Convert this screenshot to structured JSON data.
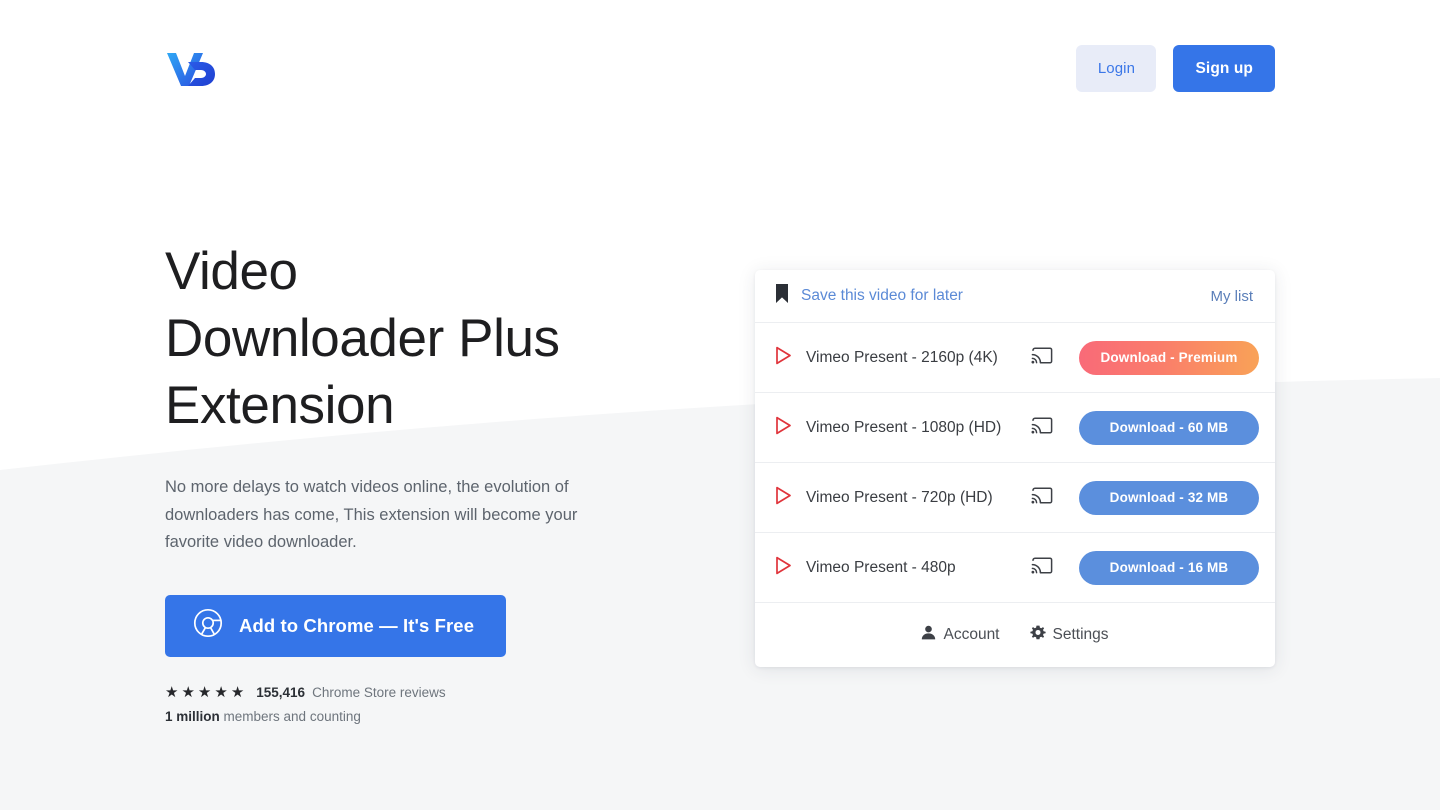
{
  "brand": {
    "logo_icon": "vd-monogram-logo",
    "logo_text": "VD",
    "accent_blue": "#3575e8",
    "login_bg": "#e8ecf8",
    "premium_gradient_from": "#f96a78",
    "premium_gradient_to": "#f9a257",
    "download_blue": "#5b8fdd"
  },
  "header": {
    "login_label": "Login",
    "signup_label": "Sign up"
  },
  "hero": {
    "title": "Video\nDownloader Plus\nExtension",
    "subtitle": "No more delays to watch videos online, the evolution of downloaders has come, This extension will become your favorite video downloader.",
    "cta_label": "Add to Chrome — It's Free",
    "cta_icon": "chrome-icon",
    "ratings": {
      "stars": 5,
      "star_icon": "star-icon",
      "review_count": "155,416",
      "review_label": "Chrome Store reviews",
      "members_count": "1 million",
      "members_label": "members and counting"
    }
  },
  "popup": {
    "header": {
      "bookmark_icon": "bookmark-icon",
      "save_label": "Save this video for later",
      "mylist_label": "My list"
    },
    "rows": [
      {
        "play_icon": "play-icon",
        "label": "Vimeo Present - 2160p (4K)",
        "cast_icon": "cast-icon",
        "download_label": "Download - Premium",
        "variant": "premium"
      },
      {
        "play_icon": "play-icon",
        "label": "Vimeo Present - 1080p (HD)",
        "cast_icon": "cast-icon",
        "download_label": "Download - 60 MB",
        "variant": "blue"
      },
      {
        "play_icon": "play-icon",
        "label": "Vimeo Present - 720p (HD)",
        "cast_icon": "cast-icon",
        "download_label": "Download - 32 MB",
        "variant": "blue"
      },
      {
        "play_icon": "play-icon",
        "label": "Vimeo Present - 480p",
        "cast_icon": "cast-icon",
        "download_label": "Download - 16 MB",
        "variant": "blue"
      }
    ],
    "footer": {
      "account_icon": "user-icon",
      "account_label": "Account",
      "settings_icon": "gear-icon",
      "settings_label": "Settings"
    }
  }
}
